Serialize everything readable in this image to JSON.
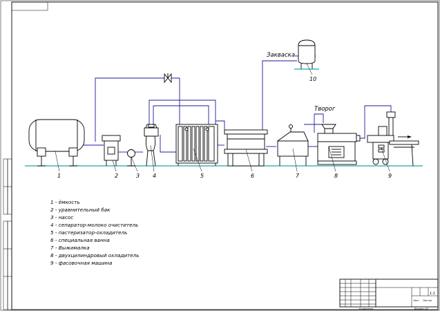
{
  "labels": {
    "zakvaska": "Закваска",
    "tvorog": "Творог"
  },
  "numbers": [
    "1",
    "2",
    "3",
    "4",
    "5",
    "6",
    "7",
    "8",
    "9",
    "10"
  ],
  "legend": [
    "1 - ёмкость",
    "2 - уравнительный бак",
    "3 - насос",
    "4 - сепаратор-молоко очиститель",
    "5 - пастеризатор-охладитель",
    "6 - специальная ванна",
    "7 - Выжималка",
    "8 - двухцилиндровый охладитель",
    "9 - фасовочная машина"
  ],
  "title_block": {
    "sheet": "Лист",
    "sheets": "Листов",
    "scale": "1:1",
    "footer_left": "Копировал",
    "footer_right": "Формат А3"
  },
  "colors": {
    "pipe": "#1a1aa0",
    "floor": "#1aa6a6",
    "outline": "#000000"
  }
}
